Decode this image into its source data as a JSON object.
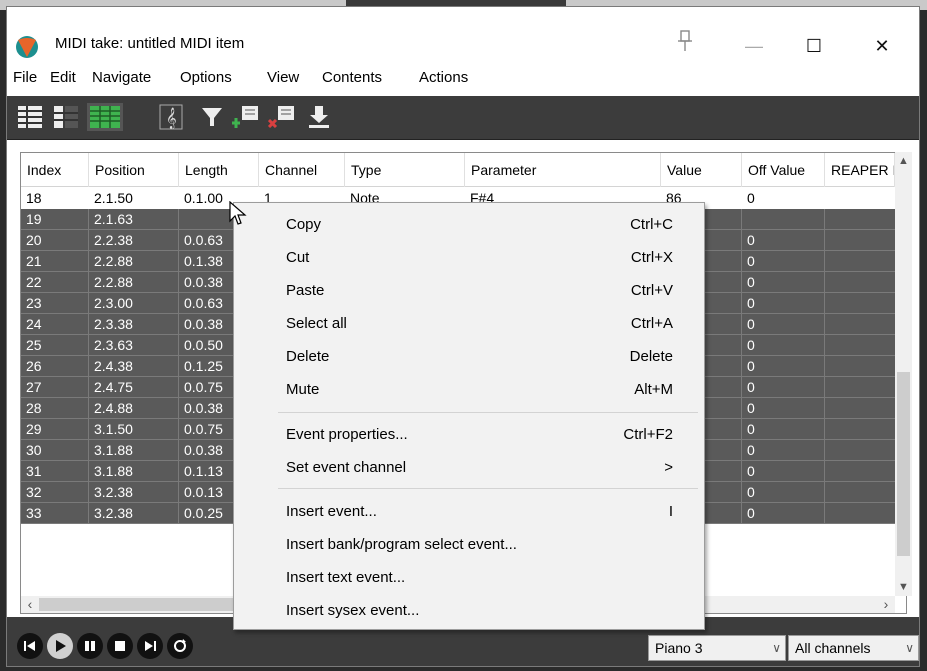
{
  "window": {
    "title": "MIDI take: untitled MIDI item",
    "buttons": [
      "—",
      "☐",
      "✕"
    ]
  },
  "menu": [
    "File",
    "Edit",
    "Navigate",
    "Options",
    "View",
    "Contents",
    "Actions"
  ],
  "columns": [
    "Index",
    "Position",
    "Length",
    "Channel",
    "Type",
    "Parameter",
    "Value",
    "Off Value",
    "REAPER I"
  ],
  "rows": [
    {
      "index": "18",
      "position": "2.1.50",
      "length": "0.1.00",
      "channel": "1",
      "type": "Note",
      "parameter": "F#4",
      "value": "86",
      "off": "0",
      "selected": false
    },
    {
      "index": "19",
      "position": "2.1.63",
      "length": "",
      "channel": "",
      "type": "",
      "parameter": "",
      "value": "",
      "off": "",
      "selected": true
    },
    {
      "index": "20",
      "position": "2.2.38",
      "length": "0.0.63",
      "off": "0",
      "selected": true
    },
    {
      "index": "21",
      "position": "2.2.88",
      "length": "0.1.38",
      "off": "0",
      "selected": true
    },
    {
      "index": "22",
      "position": "2.2.88",
      "length": "0.0.38",
      "off": "0",
      "selected": true
    },
    {
      "index": "23",
      "position": "2.3.00",
      "length": "0.0.63",
      "off": "0",
      "selected": true
    },
    {
      "index": "24",
      "position": "2.3.38",
      "length": "0.0.38",
      "off": "0",
      "selected": true
    },
    {
      "index": "25",
      "position": "2.3.63",
      "length": "0.0.50",
      "off": "0",
      "selected": true
    },
    {
      "index": "26",
      "position": "2.4.38",
      "length": "0.1.25",
      "off": "0",
      "selected": true
    },
    {
      "index": "27",
      "position": "2.4.75",
      "length": "0.0.75",
      "off": "0",
      "selected": true
    },
    {
      "index": "28",
      "position": "2.4.88",
      "length": "0.0.38",
      "off": "0",
      "selected": true
    },
    {
      "index": "29",
      "position": "3.1.50",
      "length": "0.0.75",
      "off": "0",
      "selected": true
    },
    {
      "index": "30",
      "position": "3.1.88",
      "length": "0.0.38",
      "off": "0",
      "selected": true
    },
    {
      "index": "31",
      "position": "3.1.88",
      "length": "0.1.13",
      "off": "0",
      "selected": true
    },
    {
      "index": "32",
      "position": "3.2.38",
      "length": "0.0.13",
      "off": "0",
      "selected": true
    },
    {
      "index": "33",
      "position": "3.2.38",
      "length": "0.0.25",
      "off": "0",
      "selected": true
    }
  ],
  "context_menu": [
    {
      "label": "Copy",
      "shortcut": "Ctrl+C"
    },
    {
      "label": "Cut",
      "shortcut": "Ctrl+X"
    },
    {
      "label": "Paste",
      "shortcut": "Ctrl+V"
    },
    {
      "label": "Select all",
      "shortcut": "Ctrl+A"
    },
    {
      "label": "Delete",
      "shortcut": "Delete"
    },
    {
      "label": "Mute",
      "shortcut": "Alt+M"
    },
    {
      "label": "Event properties...",
      "shortcut": "Ctrl+F2"
    },
    {
      "label": "Set event channel",
      "shortcut": ">"
    },
    {
      "label": "Insert event...",
      "shortcut": "I"
    },
    {
      "label": "Insert bank/program select event...",
      "shortcut": ""
    },
    {
      "label": "Insert text event...",
      "shortcut": ""
    },
    {
      "label": "Insert sysex event...",
      "shortcut": ""
    }
  ],
  "footer": {
    "instrument": "Piano 3",
    "channels": "All channels"
  },
  "colors": {
    "selected_row": "#5a5a5a",
    "toolbar": "#3c3c3c",
    "menu_bg": "#f2f2f2",
    "logo_orange": "#e8652a",
    "logo_teal": "#1d8f8f",
    "tool_green": "#3fb34f",
    "tool_red": "#d94040"
  }
}
